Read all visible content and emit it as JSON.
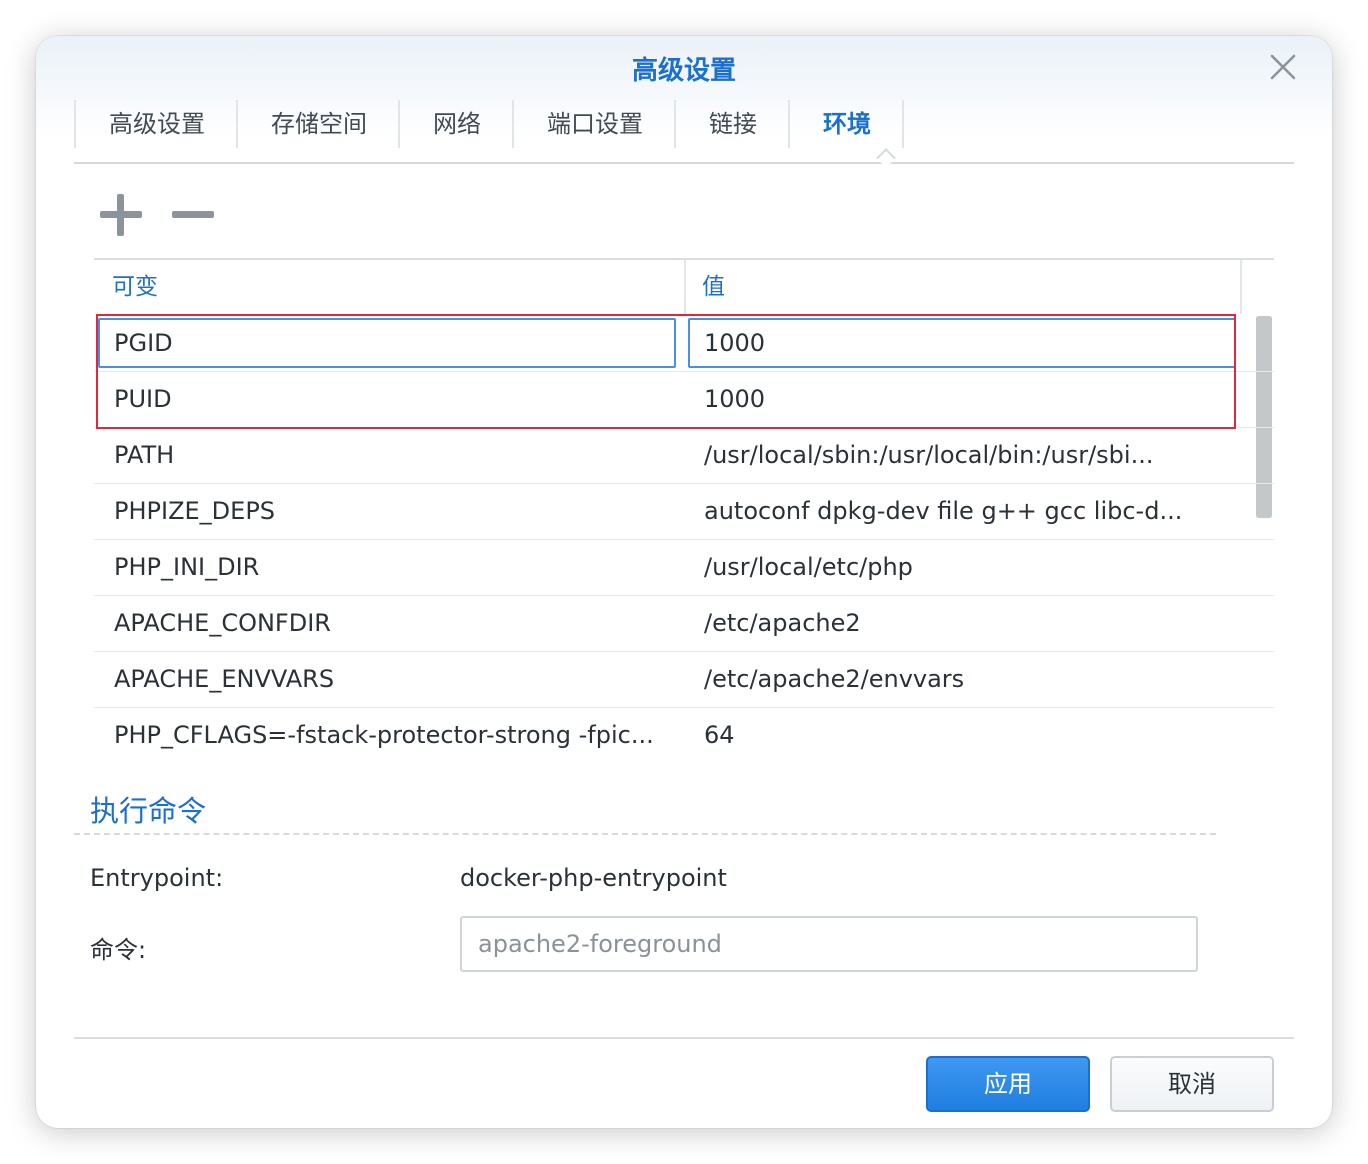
{
  "dialog": {
    "title": "高级设置"
  },
  "tabs": [
    {
      "label": "高级设置",
      "active": false
    },
    {
      "label": "存储空间",
      "active": false
    },
    {
      "label": "网络",
      "active": false
    },
    {
      "label": "端口设置",
      "active": false
    },
    {
      "label": "链接",
      "active": false
    },
    {
      "label": "环境",
      "active": true
    }
  ],
  "toolbar": {
    "add_icon": "plus-icon",
    "remove_icon": "minus-icon"
  },
  "env_table": {
    "columns": [
      "可变",
      "值"
    ],
    "rows": [
      {
        "key": "PGID",
        "value": "1000"
      },
      {
        "key": "PUID",
        "value": "1000"
      },
      {
        "key": "PATH",
        "value": "/usr/local/sbin:/usr/local/bin:/usr/sbi..."
      },
      {
        "key": "PHPIZE_DEPS",
        "value": "autoconf dpkg-dev file g++ gcc libc-d..."
      },
      {
        "key": "PHP_INI_DIR",
        "value": "/usr/local/etc/php"
      },
      {
        "key": "APACHE_CONFDIR",
        "value": "/etc/apache2"
      },
      {
        "key": "APACHE_ENVVARS",
        "value": "/etc/apache2/envvars"
      },
      {
        "key": "PHP_CFLAGS=-fstack-protector-strong -fpic...",
        "value": "64"
      }
    ]
  },
  "exec": {
    "section_title": "执行命令",
    "entrypoint_label": "Entrypoint:",
    "entrypoint_value": "docker-php-entrypoint",
    "command_label": "命令:",
    "command_value": "apache2-foreground"
  },
  "footer": {
    "apply_label": "应用",
    "cancel_label": "取消"
  },
  "colors": {
    "accent": "#1a6fcf",
    "highlight_border": "#e0283a"
  }
}
